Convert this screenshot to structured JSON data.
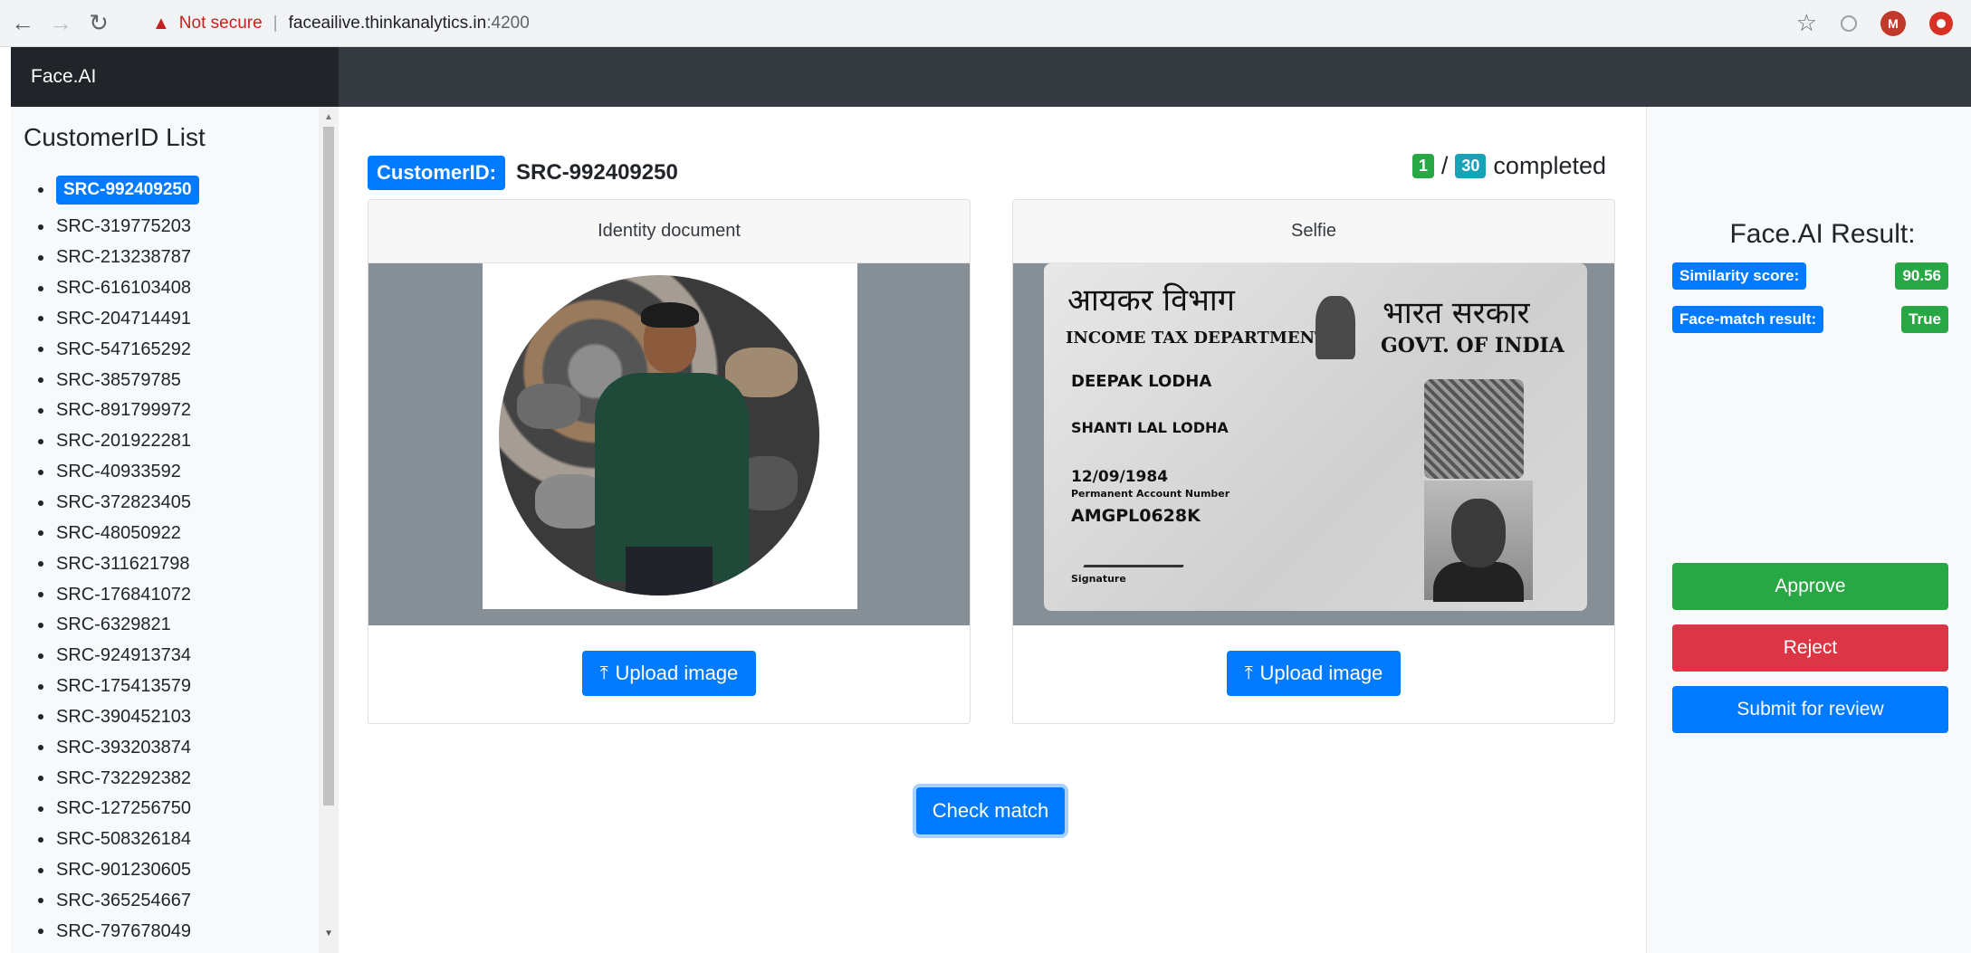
{
  "browser": {
    "security_label": "Not secure",
    "url_host": "faceailive.thinkanalytics.in",
    "url_port": ":4200",
    "profile_initial": "M"
  },
  "app": {
    "brand": "Face.AI"
  },
  "sidebar": {
    "title": "CustomerID List",
    "active_id": "SRC-992409250",
    "customer_ids": [
      "SRC-319775203",
      "SRC-213238787",
      "SRC-616103408",
      "SRC-204714491",
      "SRC-547165292",
      "SRC-38579785",
      "SRC-891799972",
      "SRC-201922281",
      "SRC-40933592",
      "SRC-372823405",
      "SRC-48050922",
      "SRC-311621798",
      "SRC-176841072",
      "SRC-6329821",
      "SRC-924913734",
      "SRC-175413579",
      "SRC-390452103",
      "SRC-393203874",
      "SRC-732292382",
      "SRC-127256750",
      "SRC-508326184",
      "SRC-901230605",
      "SRC-365254667",
      "SRC-797678049"
    ]
  },
  "main": {
    "customer_label": "CustomerID:",
    "customer_value": "SRC-992409250",
    "progress_done": "1",
    "progress_separator": "/",
    "progress_total": "30",
    "progress_text": "completed",
    "identity_card": {
      "header": "Identity document",
      "upload_label": "Upload image"
    },
    "selfie_card": {
      "header": "Selfie",
      "upload_label": "Upload image",
      "card_text": {
        "hindi_left": "आयकर विभाग",
        "hindi_right": "भारत सरकार",
        "dept": "INCOME TAX DEPARTMENT",
        "govt": "GOVT. OF INDIA",
        "name": "DEEPAK LODHA",
        "father": "SHANTI LAL LODHA",
        "dob": "12/09/1984",
        "pan_label": "Permanent Account Number",
        "pan": "AMGPL0628K",
        "signature": "Signature"
      }
    },
    "check_label": "Check match"
  },
  "result": {
    "title": "Face.AI Result:",
    "similarity_label": "Similarity score:",
    "similarity_value": "90.56",
    "match_label": "Face-match result:",
    "match_value": "True",
    "approve_label": "Approve",
    "reject_label": "Reject",
    "review_label": "Submit for review"
  },
  "colors": {
    "primary": "#007bff",
    "success": "#28a745",
    "danger": "#dc3545",
    "info": "#17a2b8",
    "navbar": "#343a40"
  }
}
